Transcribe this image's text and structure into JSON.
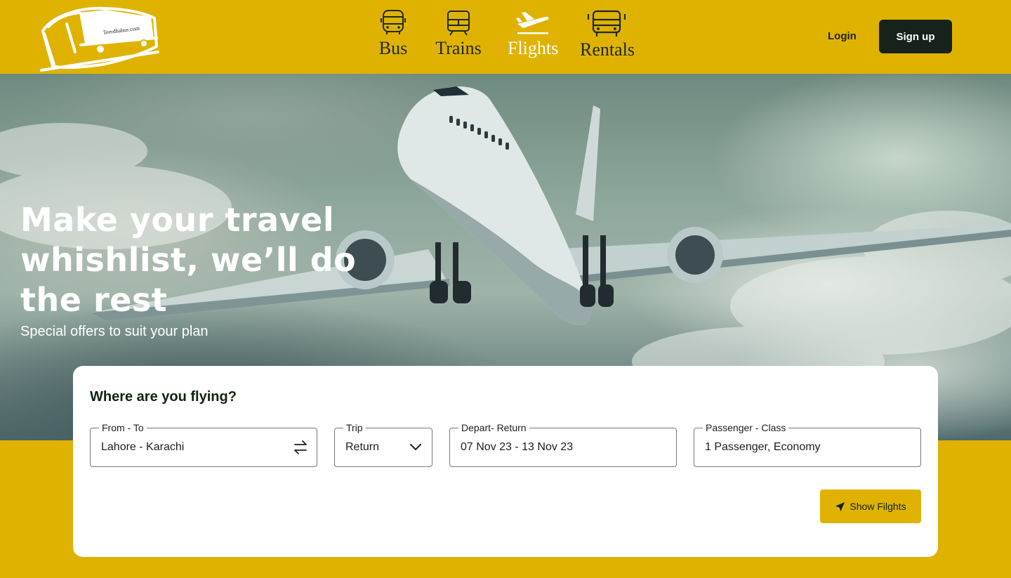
{
  "brand": {
    "logo_text": "Teerdhabus.com"
  },
  "nav": {
    "items": [
      {
        "label": "Bus",
        "icon": "bus-icon"
      },
      {
        "label": "Trains",
        "icon": "train-icon"
      },
      {
        "label": "Flights",
        "icon": "plane-icon",
        "active": true
      },
      {
        "label": "Rentals",
        "icon": "car-rental-icon"
      }
    ],
    "login_label": "Login",
    "signup_label": "Sign up"
  },
  "hero": {
    "title": "Make your travel whishlist, we’ll do the rest",
    "subtitle": "Special offers to suit your plan"
  },
  "search": {
    "heading": "Where are you flying?",
    "from_to": {
      "label": "From - To",
      "value": "Lahore - Karachi",
      "icon": "swap-icon"
    },
    "trip": {
      "label": "Trip",
      "value": "Return",
      "icon": "chevron-down-icon"
    },
    "dates": {
      "label": "Depart- Return",
      "value": "07 Nov 23 - 13 Nov 23"
    },
    "passengers": {
      "label": "Passenger - Class",
      "value": "1 Passenger, Economy"
    },
    "submit_label": "Show Filghts",
    "submit_icon": "paper-plane-icon"
  },
  "colors": {
    "accent": "#e0b200",
    "dark": "#17231a",
    "white": "#ffffff"
  }
}
